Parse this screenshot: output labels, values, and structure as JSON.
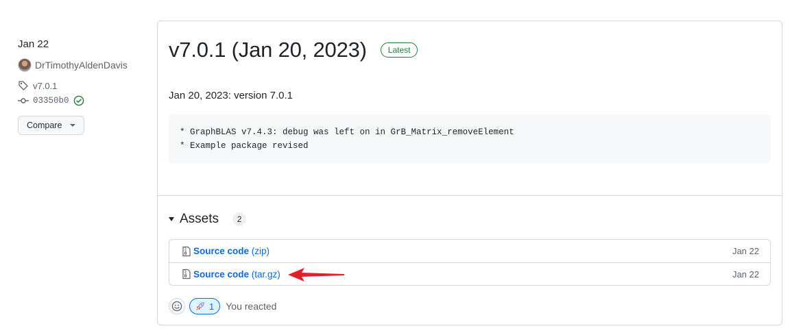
{
  "meta": {
    "date": "Jan 22",
    "author": "DrTimothyAldenDavis",
    "tag": "v7.0.1",
    "commit": "03350b0",
    "compare_label": "Compare"
  },
  "release": {
    "title": "v7.0.1 (Jan 20, 2023)",
    "badge": "Latest",
    "body": "Jan 20, 2023: version 7.0.1",
    "code_lines": [
      "* GraphBLAS v7.4.3: debug was left on in GrB_Matrix_removeElement",
      "* Example package revised"
    ]
  },
  "assets": {
    "title": "Assets",
    "count": "2",
    "items": [
      {
        "name": "Source code",
        "ext": "(zip)",
        "date": "Jan 22"
      },
      {
        "name": "Source code",
        "ext": "(tar.gz)",
        "date": "Jan 22"
      }
    ]
  },
  "reactions": {
    "rocket_count": "1",
    "reacted_text": "You reacted"
  },
  "colors": {
    "link": "#0969da",
    "latest_badge": "#1a7f37",
    "annotation_arrow": "#e0212b"
  }
}
